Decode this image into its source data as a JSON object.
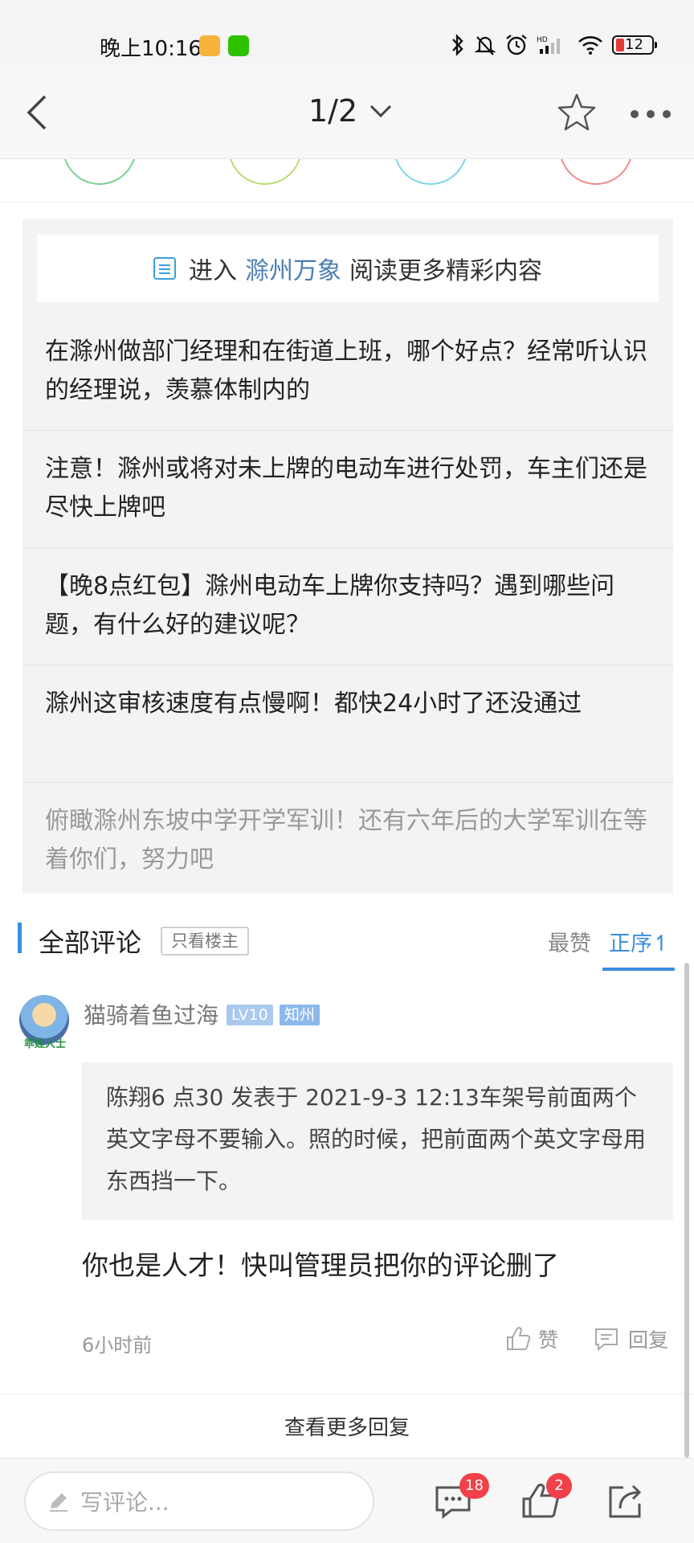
{
  "status_bar": {
    "time": "晚上10:16",
    "battery_level": "12",
    "icons": [
      "alipay-icon",
      "wechat-icon",
      "bluetooth-icon",
      "mute-icon",
      "alarm-icon",
      "hd-signal-icon",
      "wifi-icon",
      "battery-icon"
    ]
  },
  "nav": {
    "page_indicator": "1/2",
    "icons": [
      "back-arrow-icon",
      "chevron-down-icon",
      "star-icon",
      "more-icon"
    ]
  },
  "related": {
    "banner_prefix": "进入",
    "banner_link": "滁州万象",
    "banner_suffix": "阅读更多精彩内容",
    "items": [
      "在滁州做部门经理和在街道上班，哪个好点？经常听认识的经理说，羡慕体制内的",
      "注意！滁州或将对未上牌的电动车进行处罚，车主们还是尽快上牌吧",
      "【晚8点红包】滁州电动车上牌你支持吗？遇到哪些问题，有什么好的建议呢？",
      "滁州这审核速度有点慢啊！都快24小时了还没通过",
      "俯瞰滁州东坡中学开学军训！还有六年后的大学军训在等着你们，努力吧"
    ]
  },
  "comments": {
    "title": "全部评论",
    "op_only": "只看楼主",
    "sort_best": "最赞",
    "sort_order": "正序↿"
  },
  "comment": {
    "avatar_caption": "乖娃人士",
    "username": "猫骑着鱼过海",
    "level": "LV10",
    "rank": "知州",
    "quote": "陈翔6 点30 发表于 2021-9-3 12:13车架号前面两个英文字母不要输入。照的时候，把前面两个英文字母用东西挡一下。",
    "reply": "你也是人才！快叫管理员把你的评论删了",
    "time": "6小时前",
    "like_label": "赞",
    "reply_label": "回复"
  },
  "view_more": "查看更多回复",
  "bottom_bar": {
    "input_placeholder": "写评论...",
    "comment_count": "18",
    "like_count": "2"
  },
  "colors": {
    "accent": "#3b8de0",
    "link": "#4a7fb2",
    "badge_red": "#f0414a"
  }
}
